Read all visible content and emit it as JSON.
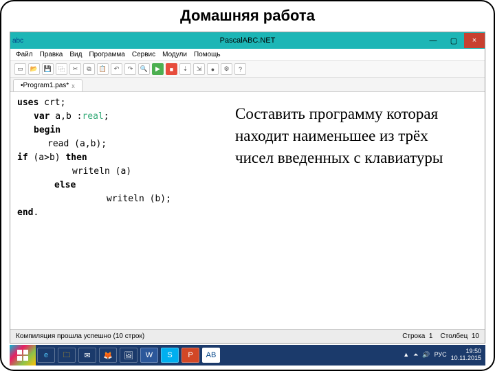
{
  "slide": {
    "title": "Домашняя работа"
  },
  "window": {
    "app_title": "PascalABC.NET",
    "minimize": "—",
    "maximize": "▢",
    "close": "×"
  },
  "menu": {
    "file": "Файл",
    "edit": "Правка",
    "view": "Вид",
    "program": "Программа",
    "service": "Сервис",
    "modules": "Модули",
    "help": "Помощь"
  },
  "toolbar_icons": {
    "new": "▭",
    "open": "📂",
    "save": "💾",
    "saveall": "⿻",
    "cut": "✂",
    "copy": "⧉",
    "paste": "📋",
    "undo": "↶",
    "redo": "↷",
    "find": "🔍",
    "run": "▶",
    "stop": "■",
    "stepover": "⇣",
    "stepinto": "⇲",
    "breakpoint": "●",
    "cfg": "⚙",
    "help": "?"
  },
  "tab": {
    "name": "•Program1.pas*",
    "close": "x"
  },
  "code": {
    "l1a": "uses",
    "l1b": " crt;",
    "l2a": "var",
    "l2b": " a,b :",
    "l2c": "real",
    "l2d": ";",
    "l3": "begin",
    "l4a": "read",
    "l4b": " (a,b);",
    "l5": "",
    "l6a": "if",
    "l6b": " (a>b) ",
    "l6c": "then",
    "l7a": "writeln",
    "l7b": " (a)",
    "l8": "else",
    "l9a": "writeln",
    "l9b": " (b);",
    "l10a": "end",
    "l10b": "."
  },
  "task": {
    "text": "Составить программу которая находит наименьшее из трёх чисел введенных с клавиатуры"
  },
  "status": {
    "left": "Компиляция прошла успешно (10 строк)",
    "line_lbl": "Строка",
    "line": "1",
    "col_lbl": "Столбец",
    "col": "10"
  },
  "taskbar": {
    "icons": {
      "ie": "e",
      "folder": "🗀",
      "mail": "✉",
      "firefox": "🦊",
      "gallery": "🖼",
      "word": "W",
      "skype": "S",
      "ppt": "P",
      "pascal": "AB"
    },
    "tray": {
      "up": "▲",
      "net": "⏶",
      "vol": "🔊",
      "lang": "РУС",
      "time": "19:50",
      "date": "10.11.2015"
    }
  }
}
